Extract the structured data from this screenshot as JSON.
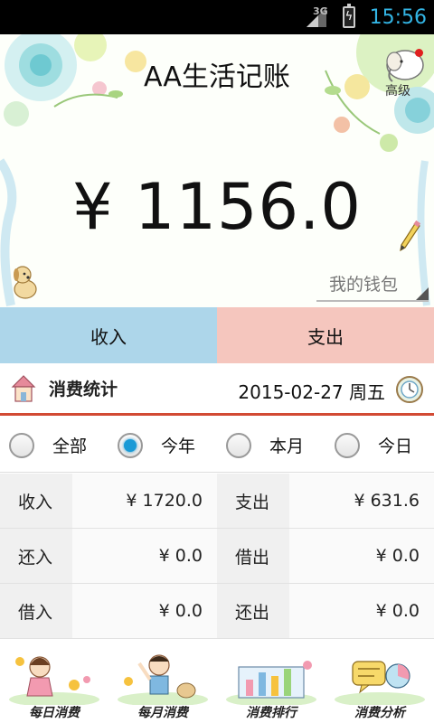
{
  "status_bar": {
    "network": "3G",
    "time": "15:56"
  },
  "header": {
    "title": "AA生活记账",
    "advanced_label": "高级",
    "balance": "¥ 1156.0",
    "wallet": "我的钱包"
  },
  "actions": {
    "income": "收入",
    "expense": "支出"
  },
  "stats": {
    "title": "消费统计",
    "date": "2015-02-27  周五",
    "ranges": [
      {
        "label": "全部",
        "checked": false
      },
      {
        "label": "今年",
        "checked": true
      },
      {
        "label": "本月",
        "checked": false
      },
      {
        "label": "今日",
        "checked": false
      }
    ],
    "rows": [
      [
        {
          "label": "收入",
          "value": "¥ 1720.0"
        },
        {
          "label": "支出",
          "value": "¥ 631.6"
        }
      ],
      [
        {
          "label": "还入",
          "value": "¥ 0.0"
        },
        {
          "label": "借出",
          "value": "¥ 0.0"
        }
      ],
      [
        {
          "label": "借入",
          "value": "¥ 0.0"
        },
        {
          "label": "还出",
          "value": "¥ 0.0"
        }
      ]
    ]
  },
  "bottom_nav": [
    {
      "label": "每日消费",
      "icon": "girl-icon"
    },
    {
      "label": "每月消费",
      "icon": "boy-icon"
    },
    {
      "label": "消费排行",
      "icon": "chart-icon"
    },
    {
      "label": "消费分析",
      "icon": "analysis-icon"
    }
  ],
  "colors": {
    "income_bg": "#add6ea",
    "expense_bg": "#f5c6be",
    "accent_line": "#d24a34",
    "radio_checked": "#1a9ad6",
    "clock": "#33b5e5"
  }
}
